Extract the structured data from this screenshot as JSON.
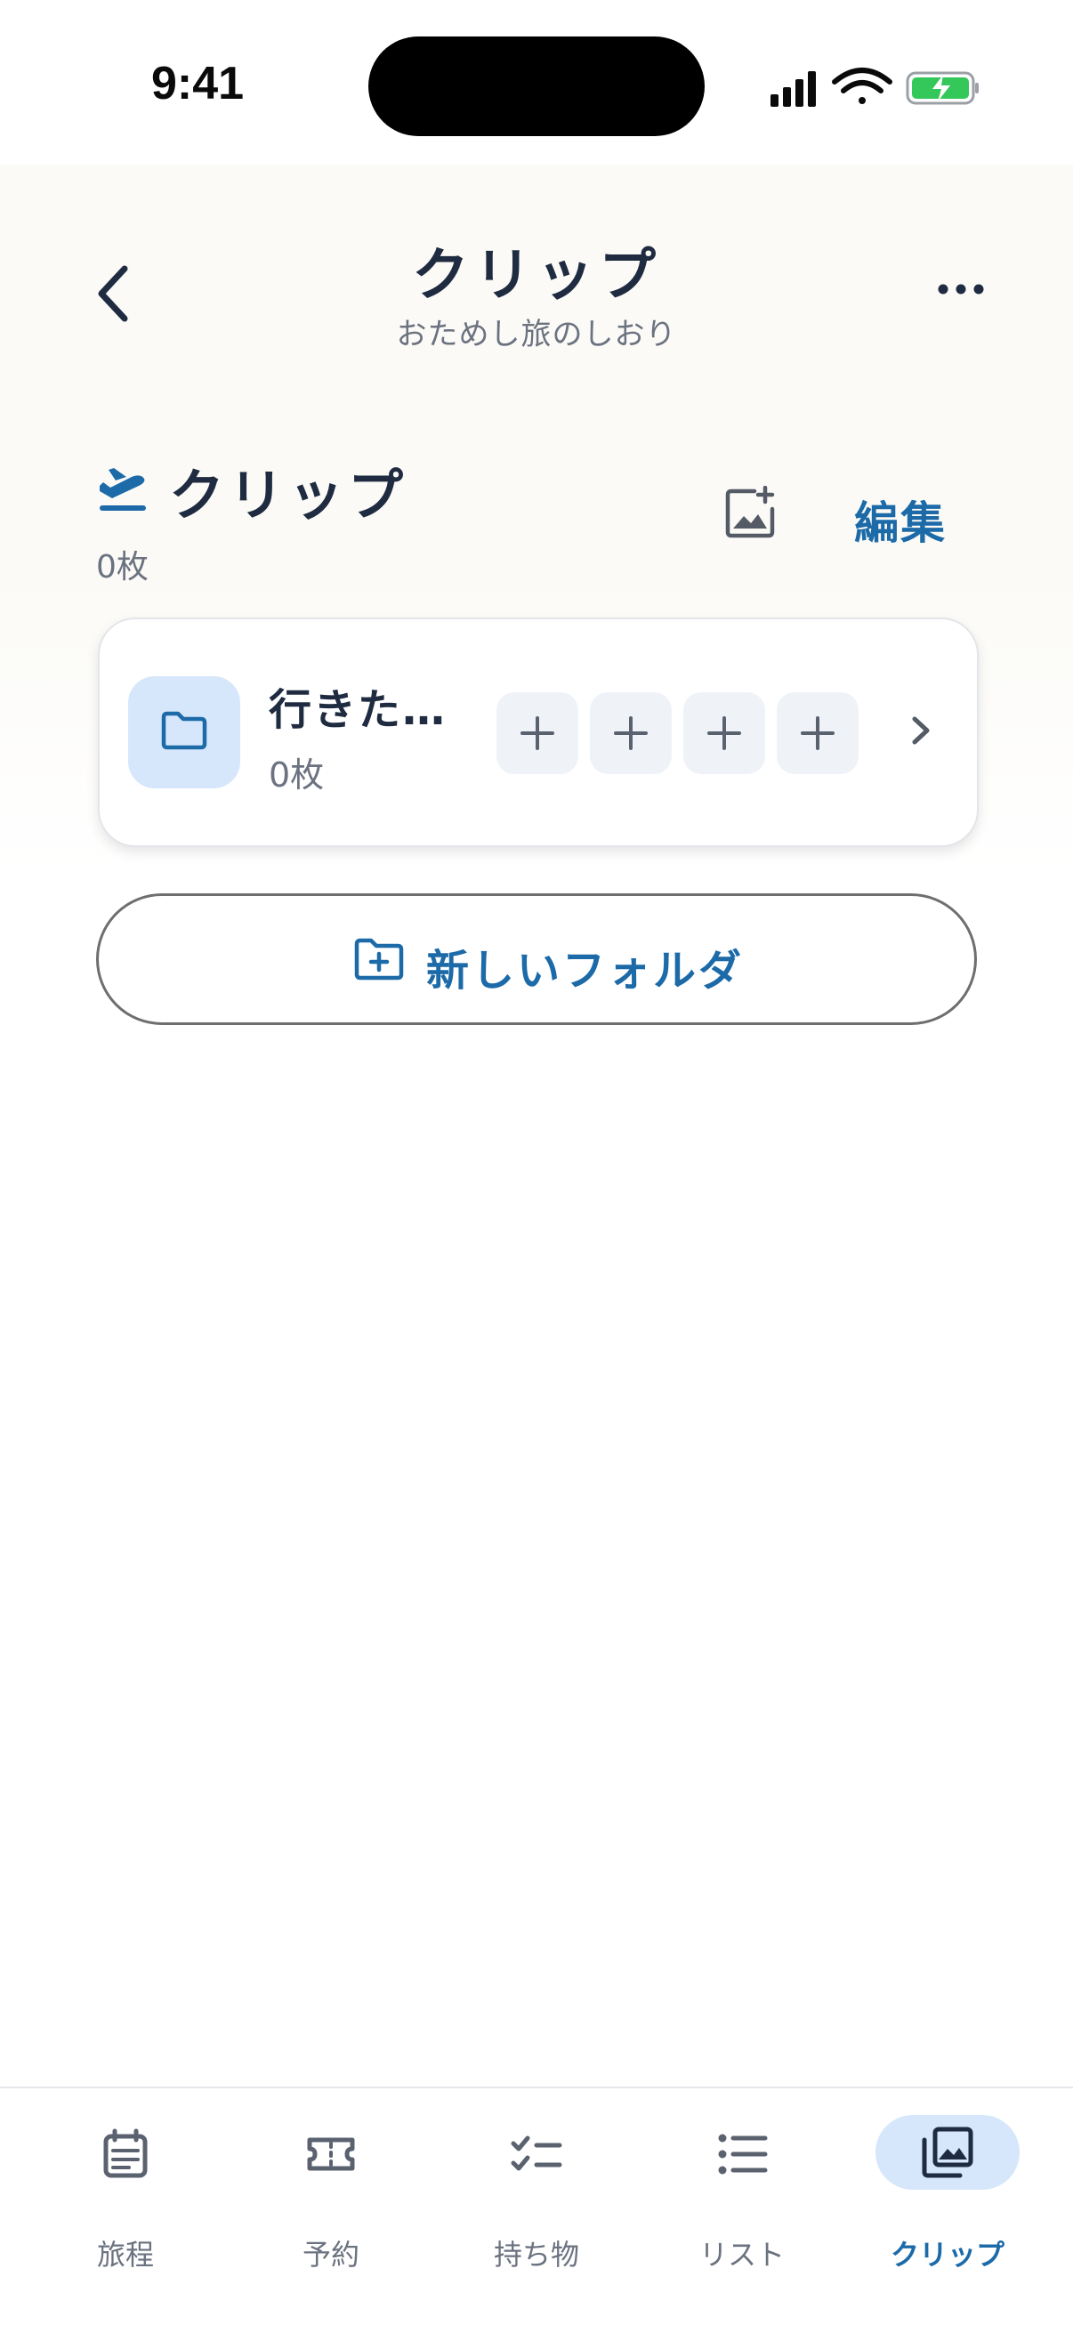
{
  "status_bar": {
    "time": "9:41"
  },
  "header": {
    "title": "クリップ",
    "subtitle": "おためし旅のしおり"
  },
  "section": {
    "title": "クリップ",
    "count": "0枚",
    "edit_label": "編集"
  },
  "folder": {
    "name": "行きた…",
    "count": "0枚"
  },
  "new_folder": {
    "label": "新しいフォルダ"
  },
  "tabs": [
    {
      "label": "旅程",
      "icon": "calendar-icon"
    },
    {
      "label": "予約",
      "icon": "ticket-icon"
    },
    {
      "label": "持ち物",
      "icon": "checklist-icon"
    },
    {
      "label": "リスト",
      "icon": "list-icon"
    },
    {
      "label": "クリップ",
      "icon": "photo-library-icon",
      "active": true
    }
  ],
  "colors": {
    "accent": "#1c6aa8",
    "text": "#1f2b40",
    "muted": "#6b7280",
    "pill": "#d6e7fb",
    "battery": "#34c759"
  }
}
